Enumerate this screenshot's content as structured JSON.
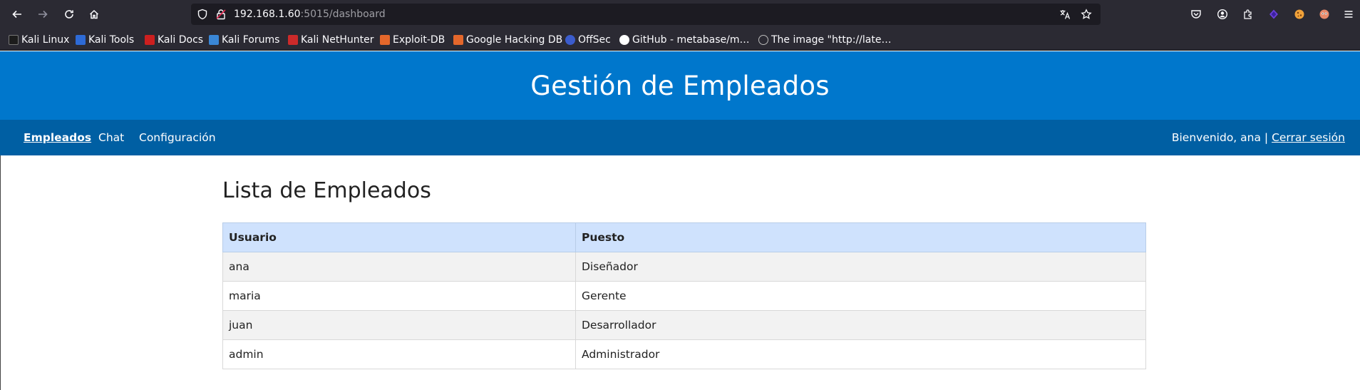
{
  "browser": {
    "url_host": "192.168.1.60",
    "url_rest": ":5015/dashboard",
    "bookmarks": [
      {
        "label": "Kali Linux",
        "color": "#1c1c1c"
      },
      {
        "label": "Kali Tools",
        "color": "#2d6ad6"
      },
      {
        "label": "Kali Docs",
        "color": "#cc1f1f"
      },
      {
        "label": "Kali Forums",
        "color": "#3a87d6"
      },
      {
        "label": "Kali NetHunter",
        "color": "#cc2a2a"
      },
      {
        "label": "Exploit-DB",
        "color": "#e4672b"
      },
      {
        "label": "Google Hacking DB",
        "color": "#e4672b"
      },
      {
        "label": "OffSec",
        "color": "#3b5ccc"
      },
      {
        "label": "GitHub - metabase/m…",
        "color": "#ffffff"
      },
      {
        "label": "The image \"http://late…",
        "color": "#bbbbbb"
      }
    ]
  },
  "header": {
    "title": "Gestión de Empleados"
  },
  "nav": {
    "items": [
      {
        "label": "Empleados",
        "active": true
      },
      {
        "label": "Chat",
        "active": false
      },
      {
        "label": "Configuración",
        "active": false
      }
    ],
    "welcome": "Bienvenido, ana | ",
    "logout": "Cerrar sesión"
  },
  "main": {
    "heading": "Lista de Empleados",
    "columns": [
      "Usuario",
      "Puesto"
    ],
    "rows": [
      [
        "ana",
        "Diseñador"
      ],
      [
        "maria",
        "Gerente"
      ],
      [
        "juan",
        "Desarrollador"
      ],
      [
        "admin",
        "Administrador"
      ]
    ]
  }
}
